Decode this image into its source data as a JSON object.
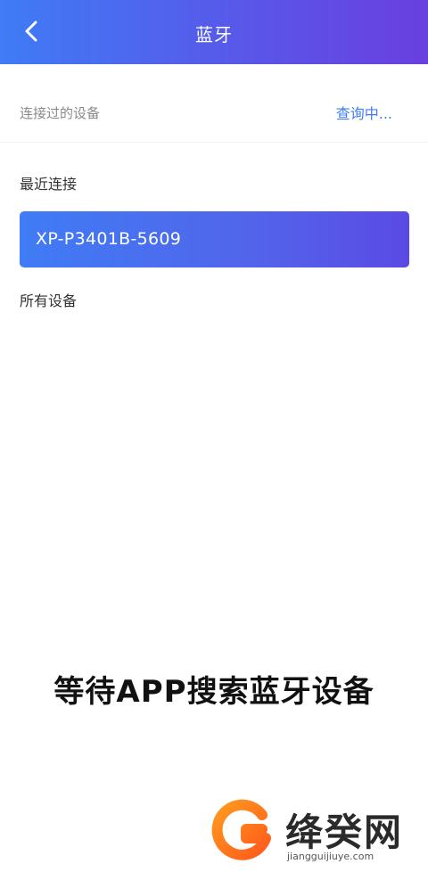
{
  "header": {
    "title": "蓝牙",
    "back_icon": "chevron-left-icon"
  },
  "connected_devices": {
    "label": "连接过的设备",
    "status": "查询中..."
  },
  "recent": {
    "label": "最近连接",
    "device_name": "XP-P3401B-5609"
  },
  "all_devices": {
    "label": "所有设备"
  },
  "overlay_caption": "等待APP搜索蓝牙设备",
  "watermark": {
    "name": "绛癸网",
    "url": "jiangguijiuye.com"
  },
  "colors": {
    "accent": "#3f7cf5",
    "accent_end": "#5a4ae4"
  }
}
